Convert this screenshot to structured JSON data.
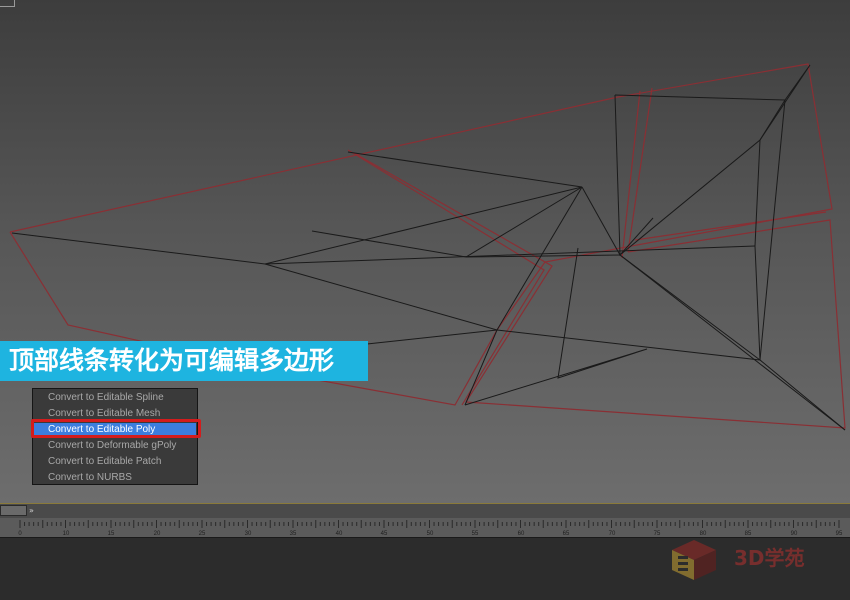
{
  "viewport": {
    "corner_label": ""
  },
  "caption": "顶部线条转化为可编辑多边形",
  "quad_menu": {
    "items": [
      "Convert to Editable Spline",
      "Convert to Editable Mesh",
      "Convert to Editable Poly",
      "Convert to Deformable gPoly",
      "Convert to Editable Patch",
      "Convert to NURBS"
    ],
    "selected_index": 2
  },
  "timeline": {
    "arrow": "»",
    "ticks": [
      "0",
      "10",
      "15",
      "20",
      "25",
      "30",
      "35",
      "40",
      "45",
      "50",
      "55",
      "60",
      "65",
      "70",
      "75",
      "80",
      "85",
      "90",
      "95"
    ]
  },
  "watermark": {
    "text": "3D学苑"
  },
  "colors": {
    "banner": "#1eb4e0",
    "selection_highlight": "#3c7ede",
    "selection_outline": "#d41c1c",
    "wire_red": "#8a2f34",
    "wire_black": "#1a1a1a"
  }
}
